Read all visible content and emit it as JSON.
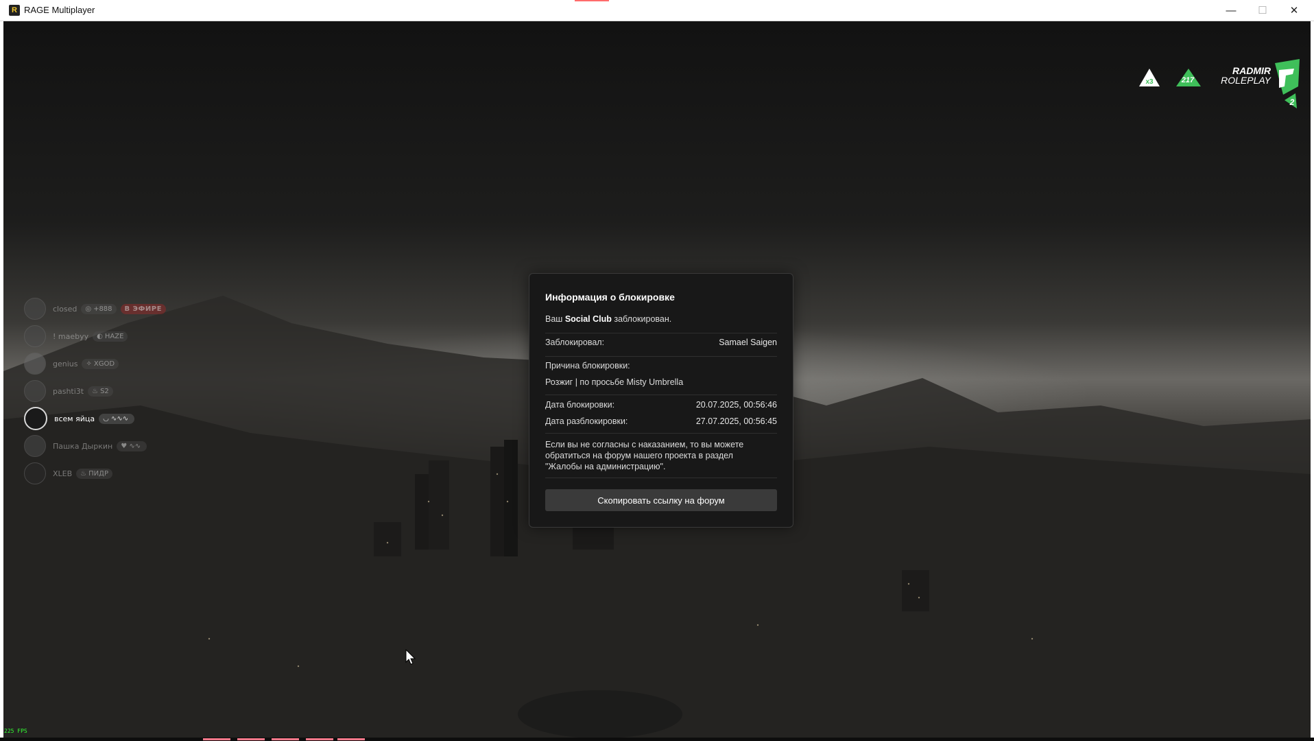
{
  "window": {
    "title": "RAGE Multiplayer",
    "icon_glyph": "R",
    "minimize_glyph": "—",
    "maximize_glyph": "☐",
    "close_glyph": "✕"
  },
  "hud": {
    "fps": "225 FPS",
    "multiplier": "x3",
    "online": "217",
    "brand_line1": "RADMIR",
    "brand_line2": "ROLEPLAY",
    "server_number": "2",
    "accent_color": "#3fbf5a"
  },
  "streamers": [
    {
      "name": "closed",
      "tag": "+888",
      "badge": "В ЭФИРЕ"
    },
    {
      "name": "! maebyy",
      "tag": "HAZE"
    },
    {
      "name": "genius",
      "tag": "XGOD"
    },
    {
      "name": "pashti3t",
      "tag": "S2"
    },
    {
      "name": "всем яйца",
      "tag": ""
    },
    {
      "name": "Пашка Дыркин",
      "tag": ""
    },
    {
      "name": "XLEB",
      "tag": "ПИДР"
    }
  ],
  "ban_modal": {
    "title": "Информация о блокировке",
    "account_prefix": "Ваш",
    "account_bold": "Social Club",
    "account_suffix": "заблокирован.",
    "blocked_by_label": "Заблокировал:",
    "blocked_by_value": "Samael Saigen",
    "reason_label": "Причина блокировки:",
    "reason_value": "Розжиг | по просьбе Misty Umbrella",
    "ban_date_label": "Дата блокировки:",
    "ban_date_value": "20.07.2025, 00:56:46",
    "unban_date_label": "Дата разблокировки:",
    "unban_date_value": "27.07.2025, 00:56:45",
    "appeal_text": "Если вы не согласны с наказанием, то вы можете обратиться на форум нашего проекта в раздел \"Жалобы на администрацию\".",
    "copy_button": "Скопировать ссылку на форум"
  }
}
